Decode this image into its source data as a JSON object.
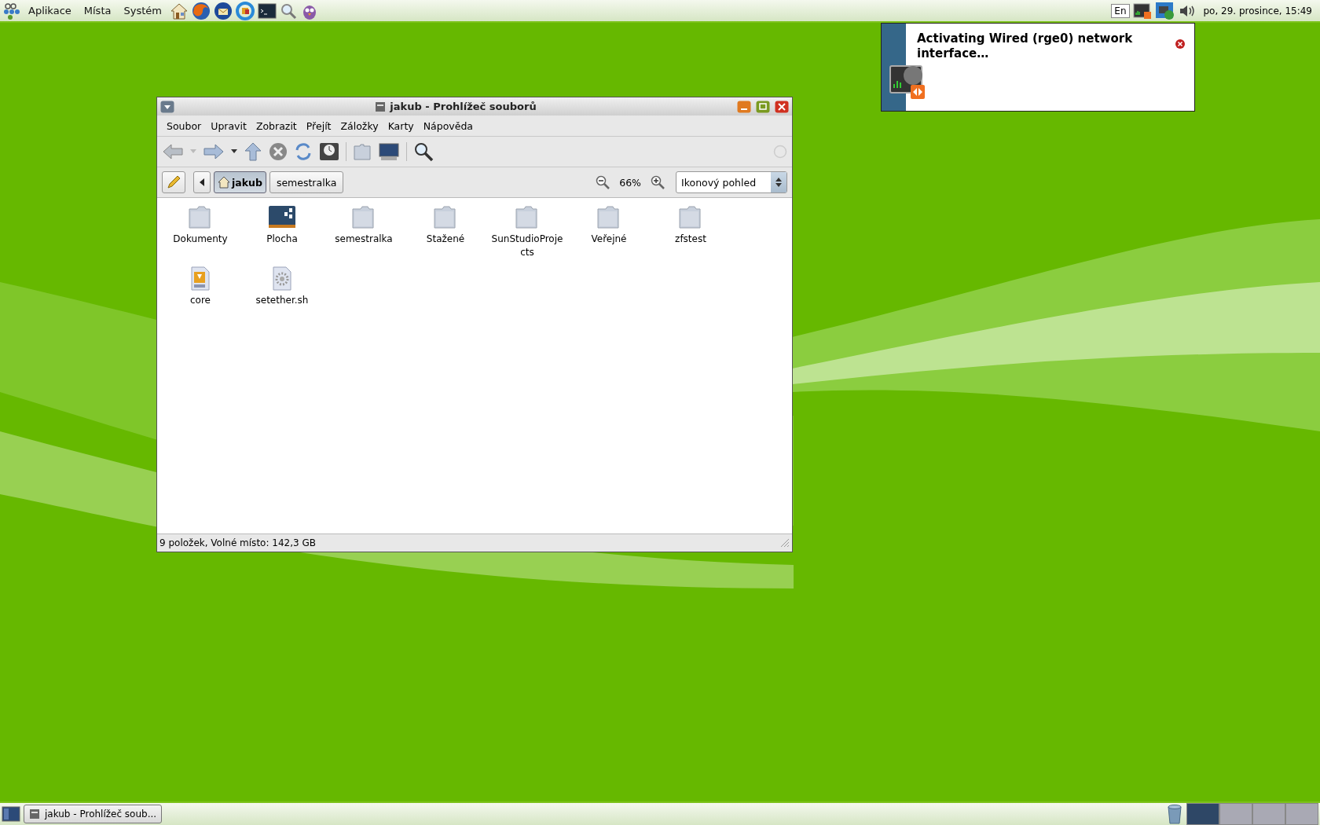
{
  "top_panel": {
    "menus": [
      "Aplikace",
      "Místa",
      "Systém"
    ],
    "keyboard_layout": "En",
    "clock": "po, 29. prosince, 15:49"
  },
  "notification": {
    "message": "Activating Wired (rge0) network interface…"
  },
  "window": {
    "title": "jakub - Prohlížeč souborů",
    "menu": [
      "Soubor",
      "Upravit",
      "Zobrazit",
      "Přejít",
      "Záložky",
      "Karty",
      "Nápověda"
    ],
    "path": [
      {
        "label": "jakub",
        "selected": true
      },
      {
        "label": "semestralka",
        "selected": false
      }
    ],
    "zoom": "66%",
    "view": "Ikonový pohled",
    "files": [
      {
        "name": "Dokumenty",
        "kind": "folder"
      },
      {
        "name": "Plocha",
        "kind": "desktop"
      },
      {
        "name": "semestralka",
        "kind": "folder"
      },
      {
        "name": "Stažené",
        "kind": "folder"
      },
      {
        "name": "SunStudioProjects",
        "kind": "folder"
      },
      {
        "name": "Veřejné",
        "kind": "folder"
      },
      {
        "name": "zfstest",
        "kind": "folder"
      },
      {
        "name": "core",
        "kind": "core"
      },
      {
        "name": "setether.sh",
        "kind": "script"
      }
    ],
    "status": "9 položek, Volné místo: 142,3 GB"
  },
  "taskbar": {
    "tasks": [
      "jakub - Prohlížeč soub..."
    ],
    "workspaces": [
      {
        "selected": true
      },
      {
        "selected": false
      },
      {
        "selected": false
      },
      {
        "selected": false
      }
    ]
  }
}
